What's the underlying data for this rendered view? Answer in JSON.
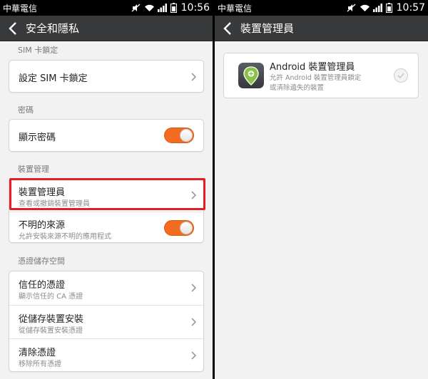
{
  "status_left": {
    "carrier": "中華電信",
    "time": "10:56"
  },
  "status_right": {
    "carrier": "中華電信",
    "time": "10:57"
  },
  "left": {
    "title": "安全和隱私",
    "sim_section": "SIM 卡鎖定",
    "sim_lock": "設定 SIM 卡鎖定",
    "password_section": "密碼",
    "show_password": "顯示密碼",
    "device_section": "裝置管理",
    "device_admin": {
      "title": "裝置管理員",
      "subtitle": "查看或撤銷裝置管理員"
    },
    "unknown_sources": {
      "title": "不明的來源",
      "subtitle": "允許安裝來源不明的應用程式"
    },
    "cred_section": "憑證儲存空間",
    "trusted_creds": {
      "title": "信任的憑證",
      "subtitle": "顯示信任的 CA 憑證"
    },
    "install_storage": {
      "title": "從儲存裝置安裝",
      "subtitle": "從儲存裝置安裝憑證"
    },
    "clear_creds": {
      "title": "清除憑證",
      "subtitle": "移除所有憑證"
    }
  },
  "right": {
    "title": "裝置管理員",
    "admin_item": {
      "title": "Android 裝置管理員",
      "desc_line1": "允許 Android 裝置管理員鎖定",
      "desc_line2": "或清除遺失的裝置"
    }
  },
  "colors": {
    "toggle_on": "#f26d21",
    "highlight": "#e31e24",
    "actionbar": "#38393b"
  },
  "toggles": {
    "show_password": "on",
    "unknown_sources": "on"
  }
}
